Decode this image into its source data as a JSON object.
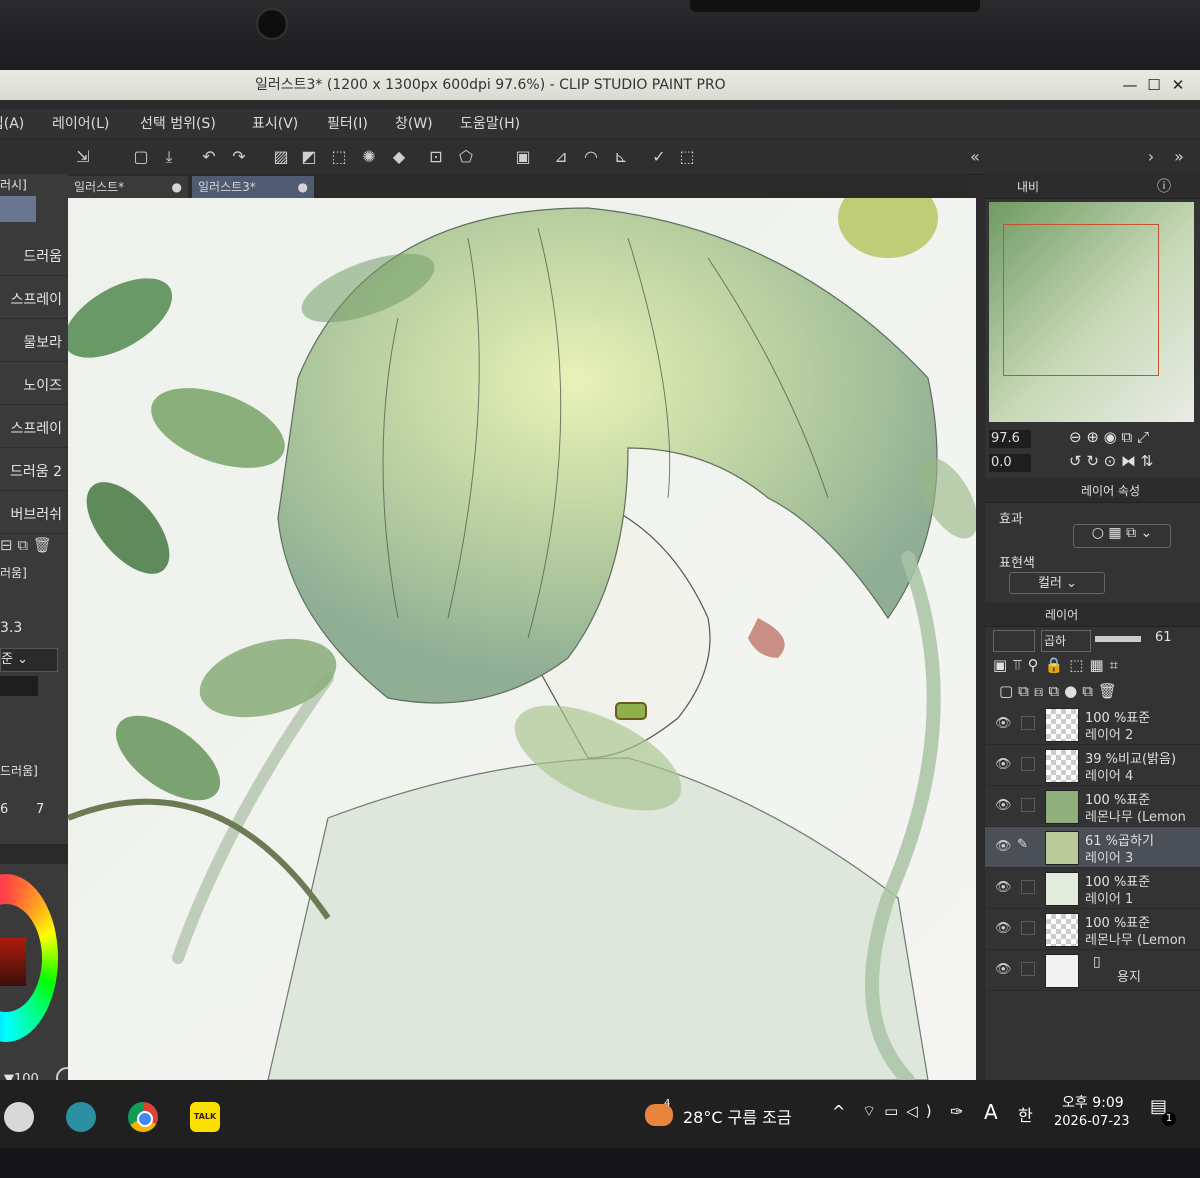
{
  "window": {
    "title": "일러스트3* (1200 x 1300px 600dpi 97.6%)  - CLIP STUDIO PAINT PRO",
    "controls": [
      "—",
      "☐",
      "✕"
    ]
  },
  "menu": [
    "편집(A)",
    "레이어(L)",
    "선택 범위(S)",
    "표시(V)",
    "필터(I)",
    "창(W)",
    "도움말(H)"
  ],
  "tabs": [
    {
      "label": "일러스트*"
    },
    {
      "label": "일러스트3*"
    }
  ],
  "left_panel": {
    "header": "러시]",
    "brushes": [
      "드러움",
      "스프레이",
      "물보라",
      "노이즈",
      "스프레이",
      "드러움 2",
      "버브러쉬"
    ],
    "section2": "러움]",
    "size_value": "3.3",
    "select_value": "준",
    "section3": "드러움]",
    "numbers": [
      "6",
      "7"
    ],
    "opacity": "100"
  },
  "right_panel": {
    "navigator_tab": "내비",
    "zoom_value": "97.6",
    "rotate_value": "0.0",
    "layer_property_tab": "레이어 속성",
    "effect_label": "효과",
    "expression_color_label": "표현색",
    "color_select": "컬러",
    "layer_tab": "레이어",
    "blend_mode": "곱하",
    "opacity_value": "61"
  },
  "layers": [
    {
      "line1": "100 %표준",
      "line2": "레이어 2",
      "selected": false
    },
    {
      "line1": "39 %비교(밝음)",
      "line2": "레이어 4",
      "selected": false
    },
    {
      "line1": "100 %표준",
      "line2": "레몬나무 (Lemon",
      "selected": false
    },
    {
      "line1": "61 %곱하기",
      "line2": "레이어 3",
      "selected": true
    },
    {
      "line1": "100 %표준",
      "line2": "레이어 1",
      "selected": false
    },
    {
      "line1": "100 %표준",
      "line2": "레몬나무 (Lemon",
      "selected": false
    },
    {
      "line1": "",
      "line2": "용지",
      "selected": false
    }
  ],
  "taskbar": {
    "weather_badge": "4",
    "weather": "28°C  구름 조금",
    "ime_a": "A",
    "ime_han": "한",
    "time": "오후 9:09",
    "date": "2026-07-23",
    "notif": "1",
    "kakao": "TALK"
  },
  "colors": {
    "accent": "#4a4f58",
    "titlebar": "#e3e4de",
    "panel": "#333333"
  }
}
